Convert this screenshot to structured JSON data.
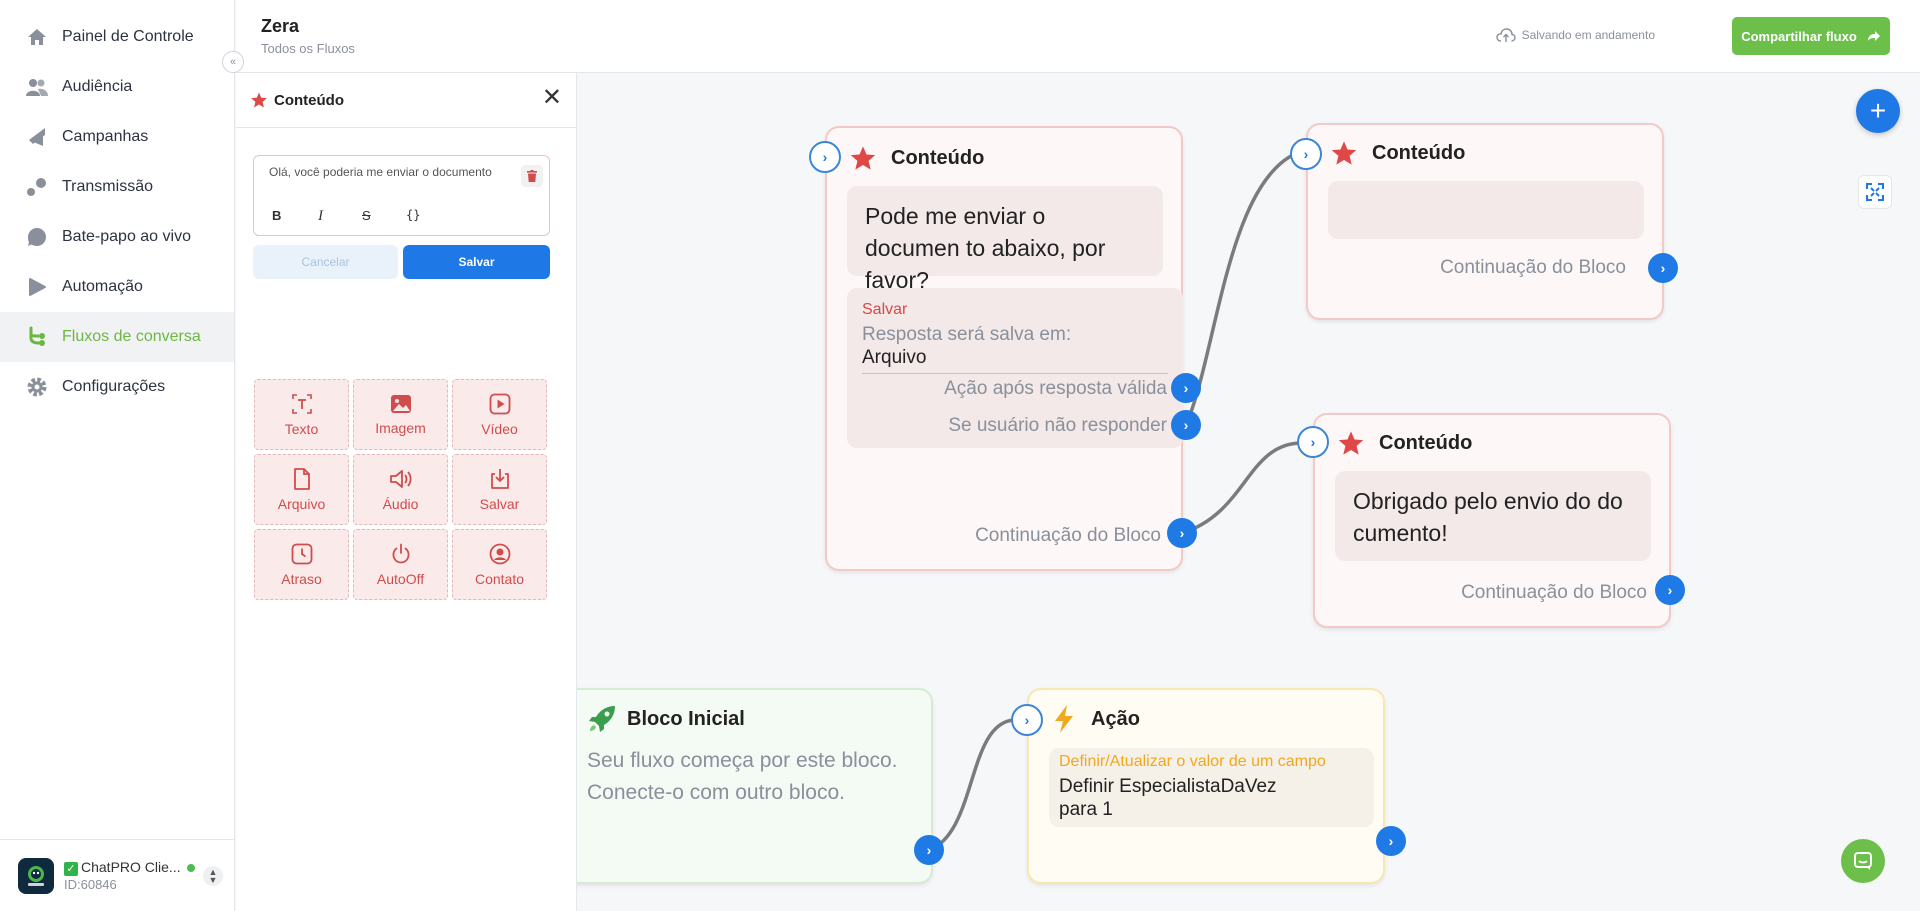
{
  "sidebar": {
    "items": [
      {
        "label": "Painel de Controle",
        "icon": "home-icon"
      },
      {
        "label": "Audiência",
        "icon": "users-icon"
      },
      {
        "label": "Campanhas",
        "icon": "megaphone-icon"
      },
      {
        "label": "Transmissão",
        "icon": "broadcast-icon"
      },
      {
        "label": "Bate-papo ao vivo",
        "icon": "chat-icon"
      },
      {
        "label": "Automação",
        "icon": "play-icon"
      },
      {
        "label": "Fluxos de conversa",
        "icon": "flow-icon",
        "active": true
      },
      {
        "label": "Configurações",
        "icon": "gear-icon"
      }
    ],
    "account": {
      "name": "ChatPRO Clie...",
      "id": "ID:60846",
      "logo_text": "ChatPRO"
    }
  },
  "header": {
    "title": "Zera",
    "subtitle": "Todos os Fluxos",
    "saving": "Salvando em andamento",
    "share": "Compartilhar fluxo"
  },
  "panel": {
    "title": "Conteúdo",
    "editor_text": "Olá, você poderia me enviar o documento",
    "format_buttons": [
      "B",
      "I",
      "S",
      "{}"
    ],
    "cancel": "Cancelar",
    "save": "Salvar",
    "tiles": [
      "Texto",
      "Imagem",
      "Vídeo",
      "Arquivo",
      "Áudio",
      "Salvar",
      "Atraso",
      "AutoOff",
      "Contato"
    ]
  },
  "canvas": {
    "node1": {
      "title": "Conteúdo",
      "message": "Pode me enviar o documen to abaixo, por favor?",
      "save_label": "Salvar",
      "save_desc": "Resposta será salva em:",
      "save_field": "Arquivo",
      "valid_action": "Ação após resposta válida",
      "no_reply": "Se usuário não responder",
      "continuation": "Continuação do Bloco"
    },
    "node2": {
      "title": "Conteúdo",
      "continuation": "Continuação do Bloco"
    },
    "node3": {
      "title": "Conteúdo",
      "message": "Obrigado pelo envio do do cumento!",
      "continuation": "Continuação do Bloco"
    },
    "start": {
      "title": "Bloco Inicial",
      "desc": "Seu fluxo começa por este bloco. Conecte-o com outro bloco."
    },
    "action": {
      "title": "Ação",
      "label": "Definir/Atualizar o valor de um campo",
      "line1": "Definir EspecialistaDaVez",
      "line2": "para 1"
    }
  },
  "colors": {
    "accent_green": "#6cc04a",
    "primary_blue": "#1e78e6",
    "content_red": "#e04848"
  }
}
